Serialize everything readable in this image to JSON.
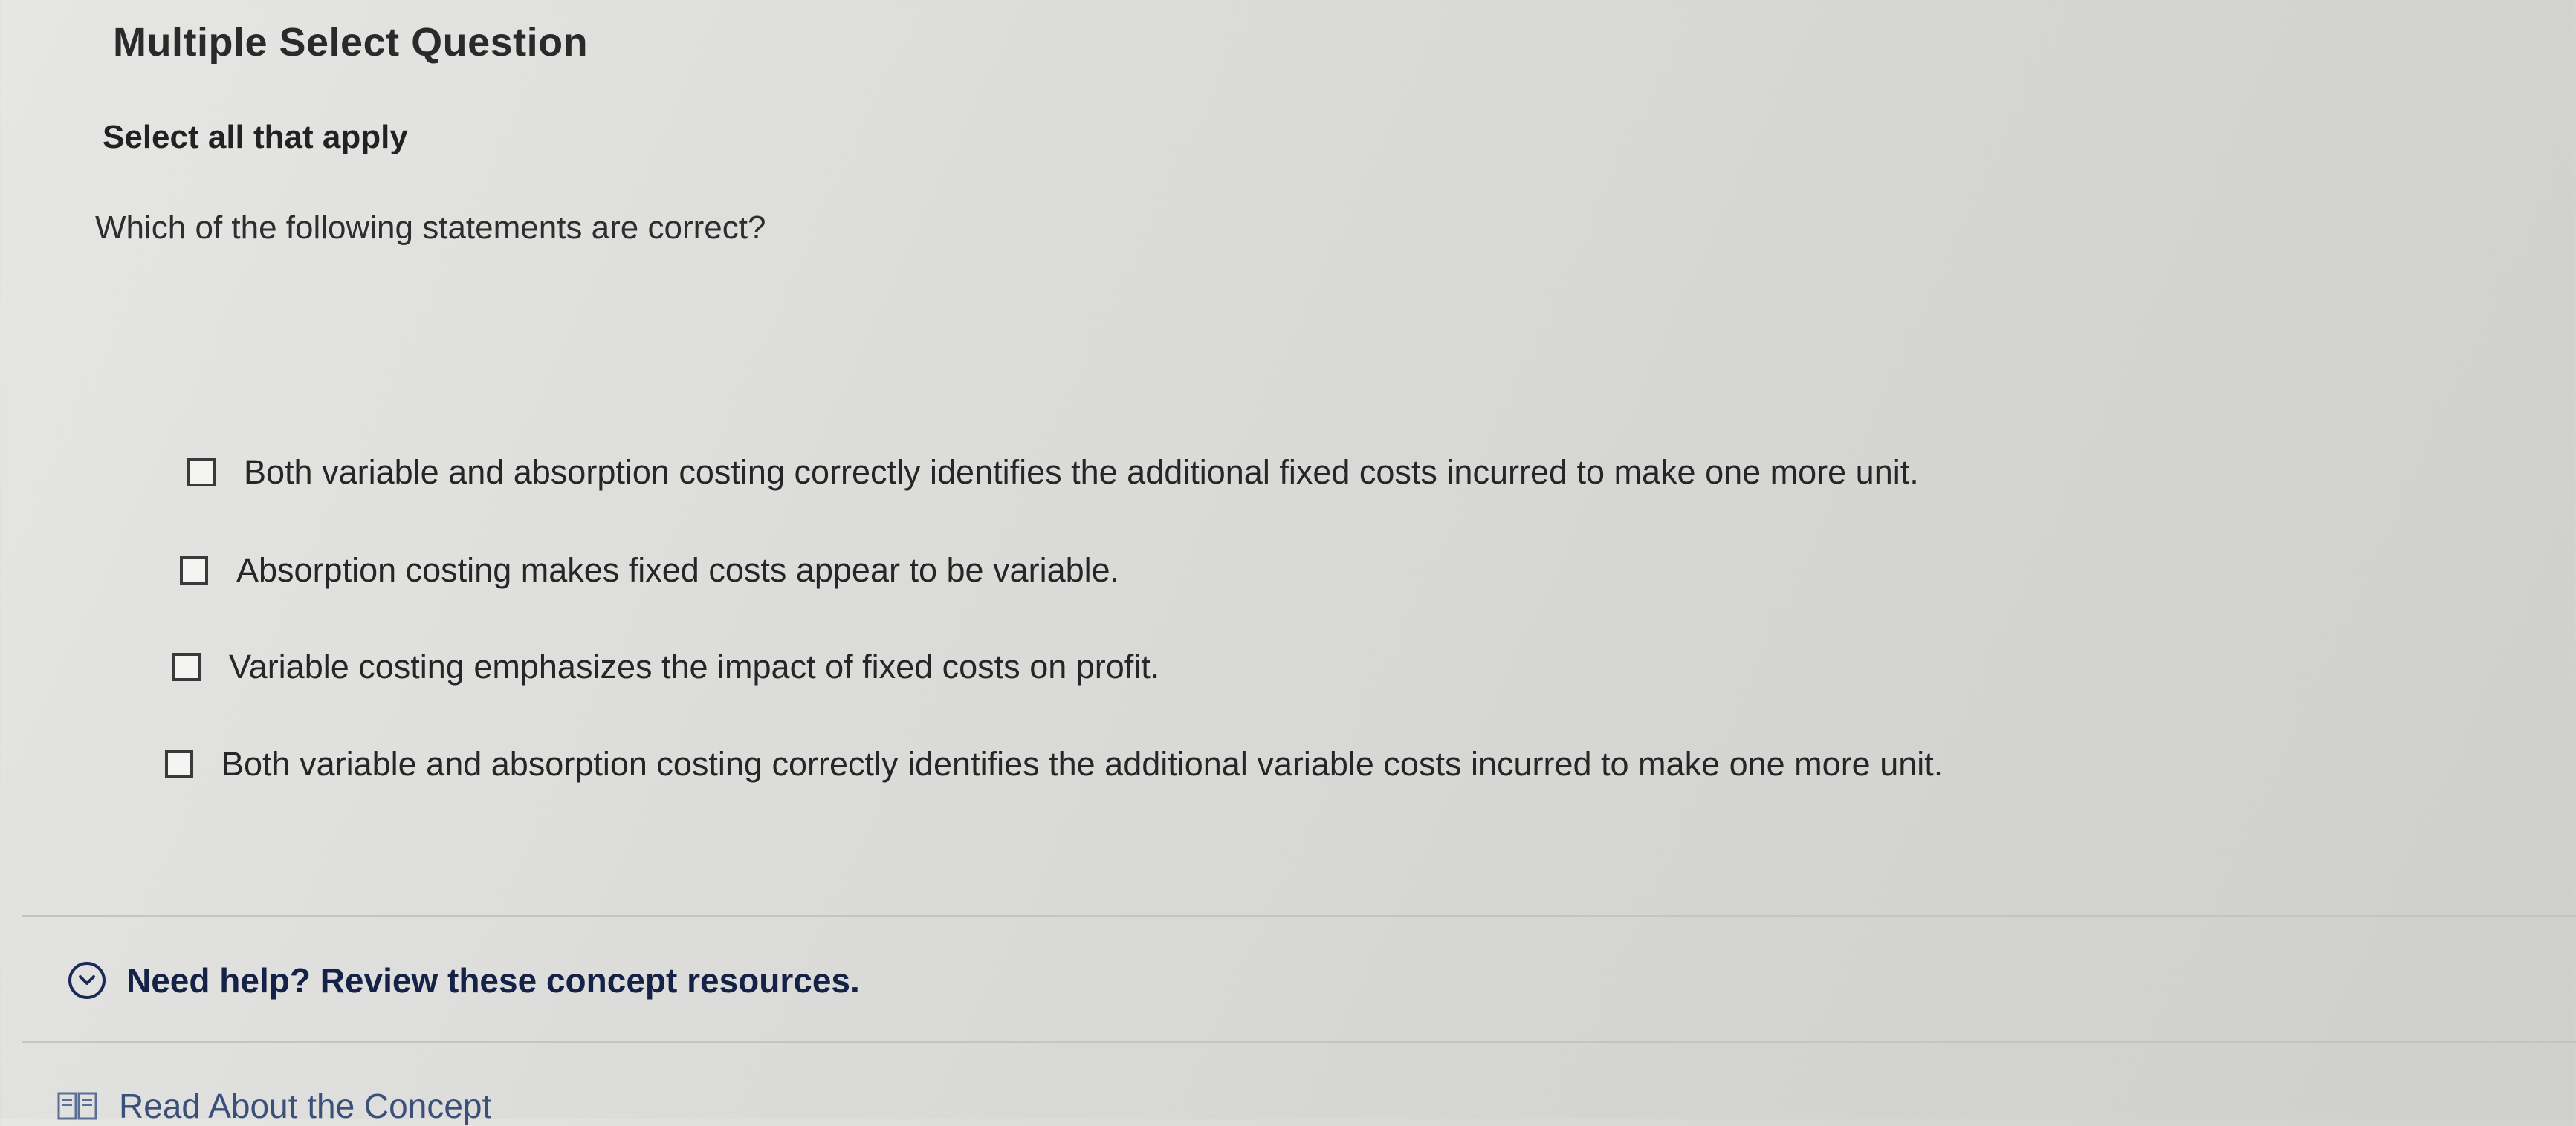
{
  "question": {
    "type_title": "Multiple Select Question",
    "instruction": "Select all that apply",
    "prompt": "Which of the following statements are correct?",
    "options": [
      {
        "label": "Both variable and absorption costing correctly identifies the additional fixed costs incurred to make one more unit.",
        "checked": false
      },
      {
        "label": "Absorption costing makes fixed costs appear to be variable.",
        "checked": false
      },
      {
        "label": "Variable costing emphasizes the impact of fixed costs on profit.",
        "checked": false
      },
      {
        "label": "Both variable and absorption costing correctly identifies the additional variable costs incurred to make one more unit.",
        "checked": false
      }
    ]
  },
  "help": {
    "toggle_label": "Need help? Review these concept resources.",
    "icon": "chevron-down-circle-icon",
    "resources": [
      {
        "label": "Read About the Concept",
        "icon": "book-icon"
      }
    ]
  },
  "colors": {
    "help_text": "#152247",
    "link_text": "#3a4f7a",
    "checkbox_border": "#3a3a3a"
  }
}
